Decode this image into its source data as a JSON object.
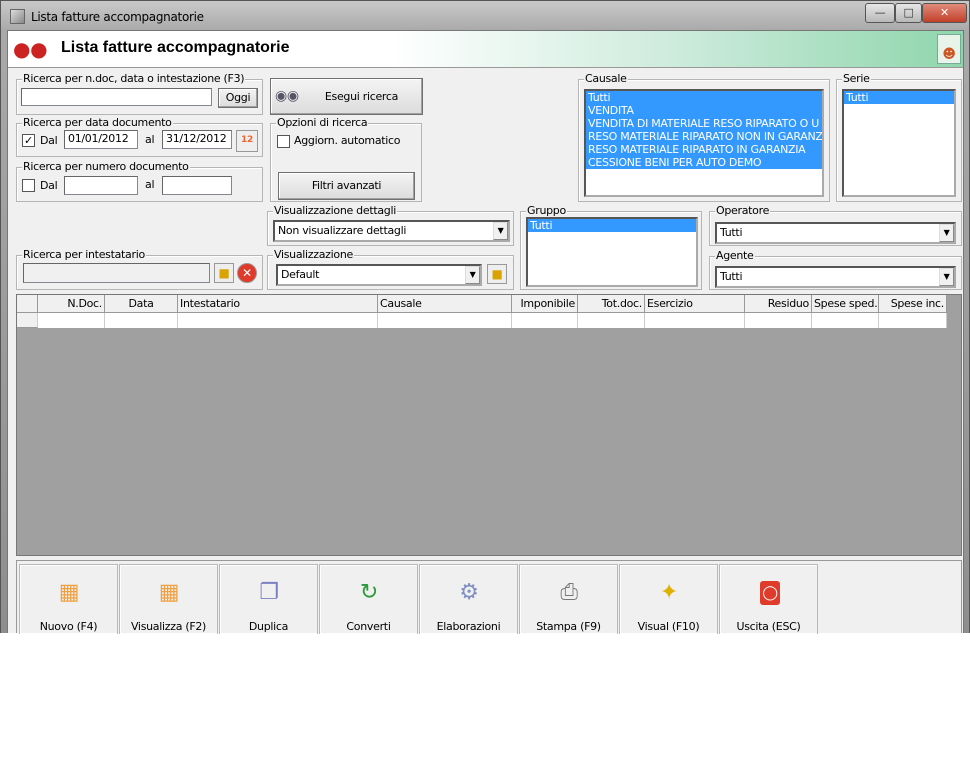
{
  "window": {
    "title": "Lista fatture accompagnatorie",
    "controls": [
      "minimize",
      "maximize",
      "close"
    ]
  },
  "header": {
    "title": "Lista fatture accompagnatorie",
    "logo_icon": "strawberry-icon",
    "right_icon": "users-list-icon"
  },
  "search_text": {
    "legend": "Ricerca per n.doc, data o intestazione (F3)",
    "value": "",
    "today_label": "Oggi"
  },
  "execute_button": {
    "label": "Esegui ricerca",
    "icon": "binoculars-icon"
  },
  "date_search": {
    "legend": "Ricerca per data documento",
    "checked": true,
    "from_label": "Dal",
    "from": "01/01/2012",
    "to_label": "al",
    "to": "31/12/2012"
  },
  "number_search": {
    "legend": "Ricerca per numero documento",
    "checked": false,
    "from_label": "Dal",
    "from": "",
    "to_label": "al",
    "to": ""
  },
  "options": {
    "legend": "Opzioni di ricerca",
    "auto_update_label": "Aggiorn. automatico",
    "auto_update": false,
    "advanced_filters": "Filtri avanzati"
  },
  "causale": {
    "legend": "Causale",
    "items": [
      "Tutti",
      "VENDITA",
      "VENDITA DI MATERIALE RESO RIPARATO O U",
      "RESO MATERIALE RIPARATO NON IN GARANZ",
      "RESO MATERIALE RIPARATO IN GARANZIA",
      "CESSIONE BENI PER AUTO DEMO"
    ]
  },
  "serie": {
    "legend": "Serie",
    "items": [
      "Tutti"
    ]
  },
  "details_view": {
    "legend": "Visualizzazione dettagli",
    "value": "Non visualizzare dettagli"
  },
  "holder_search": {
    "legend": "Ricerca per intestatario",
    "value": ""
  },
  "view": {
    "legend": "Visualizzazione",
    "value": "Default"
  },
  "gruppo": {
    "legend": "Gruppo",
    "items": [
      "Tutti"
    ]
  },
  "operatore": {
    "legend": "Operatore",
    "value": "Tutti"
  },
  "agente": {
    "legend": "Agente",
    "value": "Tutti"
  },
  "grid": {
    "columns": [
      "N.Doc.",
      "Data",
      "Intestatario",
      "Causale",
      "Imponibile",
      "Tot.doc.",
      "Esercizio",
      "Residuo",
      "Spese sped.",
      "Spese inc."
    ]
  },
  "toolbar": [
    {
      "label": "Nuovo (F4)",
      "icon": "new-grid-icon"
    },
    {
      "label": "Visualizza (F2)",
      "icon": "view-grid-icon"
    },
    {
      "label": "Duplica",
      "icon": "duplicate-icon"
    },
    {
      "label": "Converti",
      "icon": "convert-icon"
    },
    {
      "label": "Elaborazioni",
      "icon": "process-icon"
    },
    {
      "label": "Stampa (F9)",
      "icon": "printer-icon"
    },
    {
      "label": "Visual (F10)",
      "icon": "magic-wand-icon"
    },
    {
      "label": "Uscita (ESC)",
      "icon": "power-icon"
    }
  ]
}
